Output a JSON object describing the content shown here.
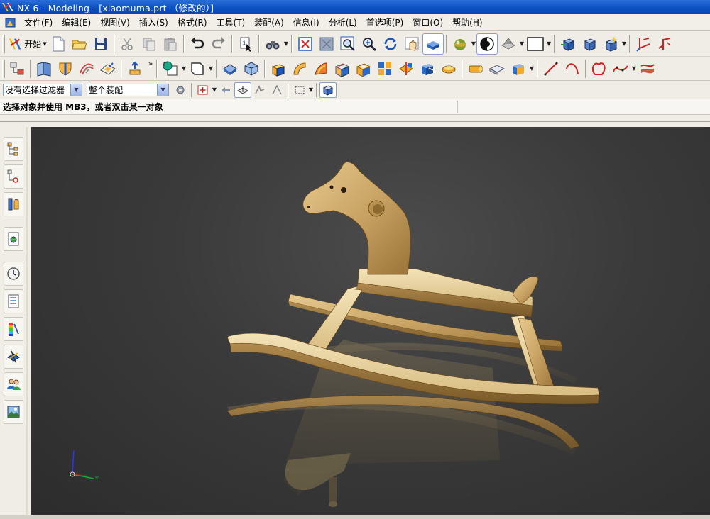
{
  "window": {
    "title": "NX 6 - Modeling - [xiaomuma.prt （修改的）]"
  },
  "menu": {
    "items": [
      {
        "label": "文件(F)"
      },
      {
        "label": "编辑(E)"
      },
      {
        "label": "视图(V)"
      },
      {
        "label": "插入(S)"
      },
      {
        "label": "格式(R)"
      },
      {
        "label": "工具(T)"
      },
      {
        "label": "装配(A)"
      },
      {
        "label": "信息(I)"
      },
      {
        "label": "分析(L)"
      },
      {
        "label": "首选项(P)"
      },
      {
        "label": "窗口(O)"
      },
      {
        "label": "帮助(H)"
      }
    ]
  },
  "toolbar": {
    "start_label": "开始",
    "more_glyph": "»"
  },
  "selection": {
    "filter_value": "没有选择过滤器",
    "scope_value": "整个装配"
  },
  "cue": {
    "text": "选择对象并使用 MB3，或者双击某一对象"
  },
  "colors": {
    "title_bar": "#0a4ec0",
    "model_wood": "#c9a465",
    "viewport_bg": "#3a3a3a"
  },
  "model": {
    "name": "rocking-horse"
  }
}
